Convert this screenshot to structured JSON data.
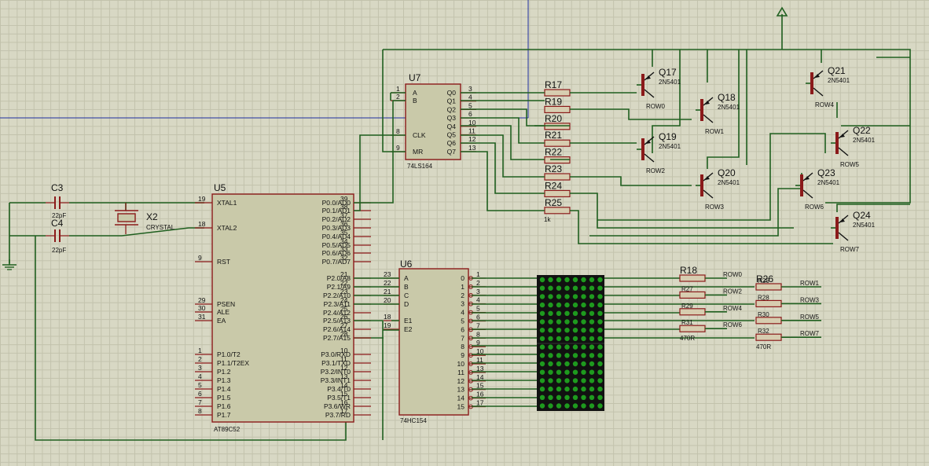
{
  "u5": {
    "ref": "U5",
    "part": "AT89C52",
    "left_pins": [
      [
        "19",
        "XTAL1"
      ],
      [
        "18",
        "XTAL2"
      ],
      [
        "9",
        "RST"
      ],
      [
        "29",
        "PSEN"
      ],
      [
        "30",
        "ALE"
      ],
      [
        "31",
        "EA"
      ],
      [
        "1",
        "P1.0/T2"
      ],
      [
        "2",
        "P1.1/T2EX"
      ],
      [
        "3",
        "P1.2"
      ],
      [
        "4",
        "P1.3"
      ],
      [
        "5",
        "P1.4"
      ],
      [
        "6",
        "P1.5"
      ],
      [
        "7",
        "P1.6"
      ],
      [
        "8",
        "P1.7"
      ]
    ],
    "right_pins": [
      [
        "39",
        "P0.0/AD0"
      ],
      [
        "38",
        "P0.1/AD1"
      ],
      [
        "37",
        "P0.2/AD2"
      ],
      [
        "36",
        "P0.3/AD3"
      ],
      [
        "35",
        "P0.4/AD4"
      ],
      [
        "34",
        "P0.5/AD5"
      ],
      [
        "33",
        "P0.6/AD6"
      ],
      [
        "32",
        "P0.7/AD7"
      ],
      [
        "21",
        "P2.0/A8"
      ],
      [
        "22",
        "P2.1/A9"
      ],
      [
        "23",
        "P2.2/A10"
      ],
      [
        "24",
        "P2.3/A11"
      ],
      [
        "25",
        "P2.4/A12"
      ],
      [
        "26",
        "P2.5/A13"
      ],
      [
        "27",
        "P2.6/A14"
      ],
      [
        "28",
        "P2.7/A15"
      ],
      [
        "10",
        "P3.0/RXD"
      ],
      [
        "11",
        "P3.1/TXD"
      ],
      [
        "12",
        "P3.2/INT0"
      ],
      [
        "13",
        "P3.3/INT1"
      ],
      [
        "14",
        "P3.4/T0"
      ],
      [
        "15",
        "P3.5/T1"
      ],
      [
        "16",
        "P3.6/WR"
      ],
      [
        "17",
        "P3.7/RD"
      ]
    ]
  },
  "u6": {
    "ref": "U6",
    "part": "74HC154",
    "left_pins": [
      [
        "23",
        "A"
      ],
      [
        "22",
        "B"
      ],
      [
        "21",
        "C"
      ],
      [
        "20",
        "D"
      ],
      [
        "18",
        "E1"
      ],
      [
        "19",
        "E2"
      ]
    ],
    "outputs": [
      "0",
      "1",
      "2",
      "3",
      "4",
      "5",
      "6",
      "7",
      "8",
      "9",
      "10",
      "11",
      "12",
      "13",
      "14",
      "15"
    ],
    "out_pins": [
      "1",
      "2",
      "3",
      "4",
      "5",
      "6",
      "7",
      "8",
      "9",
      "10",
      "11",
      "13",
      "14",
      "15",
      "16",
      "17"
    ]
  },
  "u7": {
    "ref": "U7",
    "part": "74LS164",
    "left_pins": [
      [
        "1",
        "A"
      ],
      [
        "2",
        "B"
      ],
      [
        "8",
        "CLK"
      ],
      [
        "9",
        "MR"
      ]
    ],
    "right_pins": [
      [
        "3",
        "Q0"
      ],
      [
        "4",
        "Q1"
      ],
      [
        "5",
        "Q2"
      ],
      [
        "6",
        "Q3"
      ],
      [
        "10",
        "Q4"
      ],
      [
        "11",
        "Q5"
      ],
      [
        "12",
        "Q6"
      ],
      [
        "13",
        "Q7"
      ]
    ]
  },
  "caps": [
    {
      "ref": "C3",
      "value": "22pF"
    },
    {
      "ref": "C4",
      "value": "22pF"
    }
  ],
  "crystal": {
    "ref": "X2",
    "value": "CRYSTAL"
  },
  "resistors_top": [
    "R17",
    "R19",
    "R20",
    "R21",
    "R22",
    "R23",
    "R24",
    "R25"
  ],
  "resistor_top_value": "1k",
  "resistors_col_a": [
    "R18",
    "R27",
    "R29",
    "R31",
    "R31"
  ],
  "resistors_col_b": [
    "R26",
    "R28",
    "R30",
    "R32"
  ],
  "resistor_value": "470R",
  "col_a_labels": [
    "ROW0",
    "ROW2",
    "ROW4",
    "ROW6"
  ],
  "col_b_labels": [
    "ROW1",
    "ROW3",
    "ROW5",
    "ROW7"
  ],
  "transistors": [
    {
      "ref": "Q17",
      "part": "2N5401",
      "row": "ROW0"
    },
    {
      "ref": "Q18",
      "part": "2N5401",
      "row": "ROW1"
    },
    {
      "ref": "Q19",
      "part": "2N5401",
      "row": "ROW2"
    },
    {
      "ref": "Q20",
      "part": "2N5401",
      "row": "ROW3"
    },
    {
      "ref": "Q21",
      "part": "2N5401",
      "row": "ROW4"
    },
    {
      "ref": "Q22",
      "part": "2N5401",
      "row": "ROW5"
    },
    {
      "ref": "Q23",
      "part": "2N5401",
      "row": "ROW6"
    },
    {
      "ref": "Q24",
      "part": "2N5401",
      "row": "ROW7"
    }
  ],
  "led_matrix": {
    "rows": 16,
    "cols": 8,
    "color": "#1e9a1e"
  },
  "colors": {
    "wire": "#1f5f1f",
    "component": "#8b1a1a",
    "body": "#c9c9a9",
    "background": "#d8d8c4",
    "guide": "#2030a0"
  }
}
